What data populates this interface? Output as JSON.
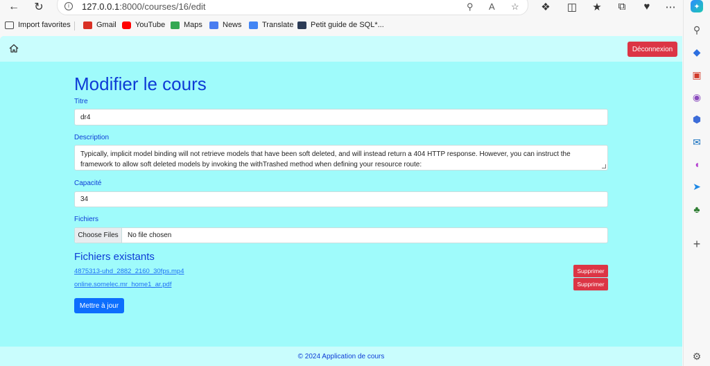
{
  "browser": {
    "url_host": "127.0.0.1",
    "url_rest": ":8000/courses/16/edit",
    "bookmarks": [
      {
        "label": "Import favorites",
        "color": "#444444"
      },
      {
        "label": "Gmail",
        "color": "#d93025"
      },
      {
        "label": "YouTube",
        "color": "#ff0000"
      },
      {
        "label": "Maps",
        "color": "#34a853"
      },
      {
        "label": "News",
        "color": "#4a7df0"
      },
      {
        "label": "Translate",
        "color": "#4285f4"
      },
      {
        "label": "Petit guide de SQL*...",
        "color": "#2b3a55"
      }
    ]
  },
  "nav": {
    "logout_label": "Déconnexion"
  },
  "form": {
    "title": "Modifier le cours",
    "titre_label": "Titre",
    "titre_value": "dr4",
    "description_label": "Description",
    "description_value": "Typically, implicit model binding will not retrieve models that have been soft deleted, and will instead return a 404 HTTP response. However, you can instruct the framework to allow soft deleted models by invoking the withTrashed method when defining your resource route:",
    "capacite_label": "Capacité",
    "capacite_value": "34",
    "fichiers_label": "Fichiers",
    "choose_files_label": "Choose Files",
    "no_file_label": "No file chosen",
    "existing_title": "Fichiers existants",
    "files": [
      {
        "name": "4875313-uhd_2882_2160_30fps.mp4",
        "delete_label": "Supprimer"
      },
      {
        "name": "online.somelec.mr_home1_ar.pdf",
        "delete_label": "Supprimer"
      }
    ],
    "submit_label": "Mettre à jour"
  },
  "footer": {
    "text": "© 2024 Application de cours"
  },
  "colors": {
    "page_bg": "#9ffbfb",
    "nav_bg": "#c9fdfd",
    "heading": "#0d3bd6",
    "danger": "#dc3545",
    "primary": "#0d6efd"
  }
}
